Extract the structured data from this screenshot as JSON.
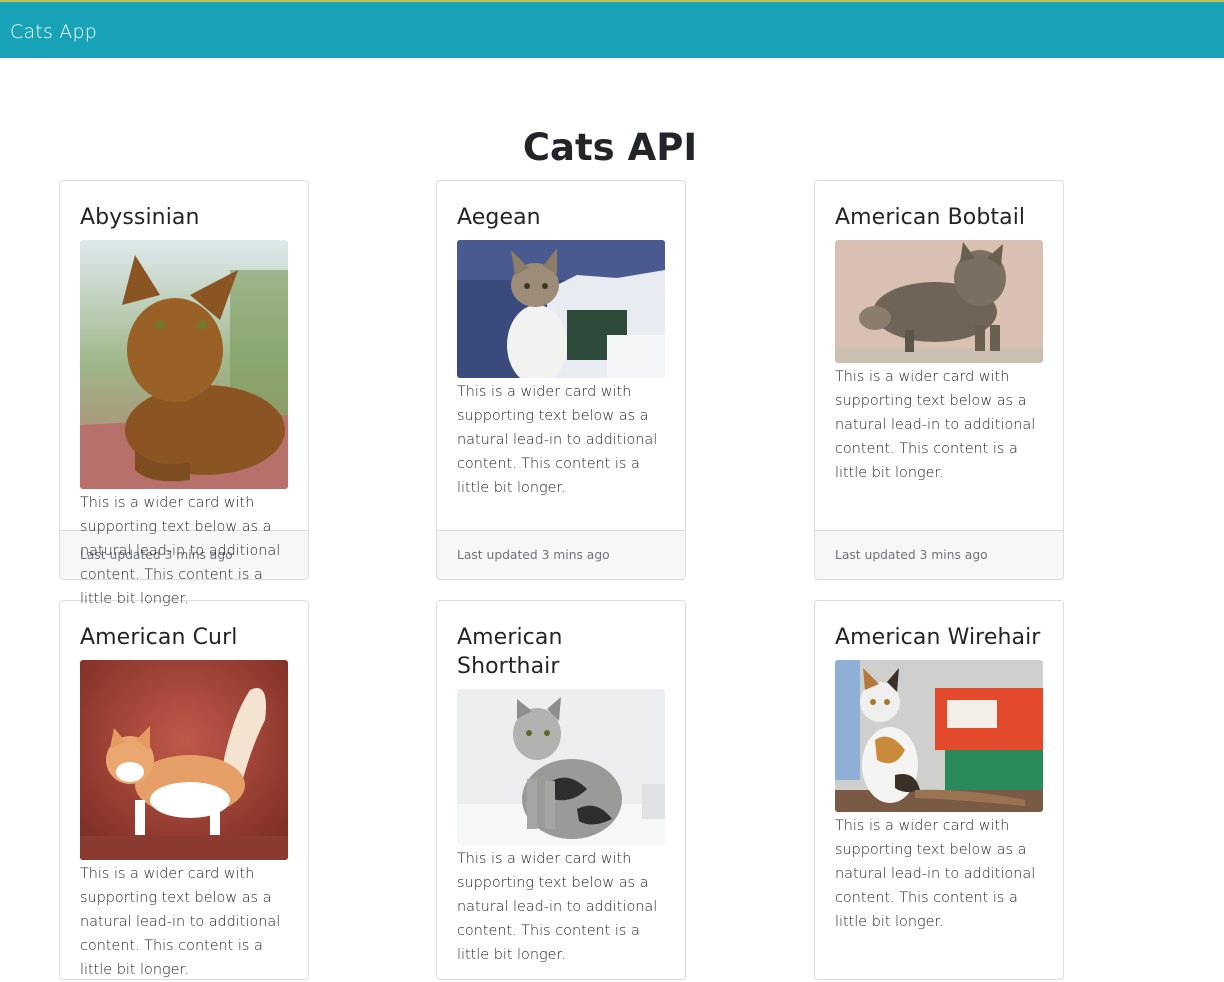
{
  "navbar": {
    "brand": "Cats App"
  },
  "page": {
    "title": "Cats API"
  },
  "cards": [
    {
      "title": "Abyssinian",
      "image": "abyssinian-cat-photo",
      "text": "This is a wider card with supporting text below as a natural lead-in to additional content. This content is a little bit longer.",
      "footer": "Last updated 3 mins ago"
    },
    {
      "title": "Aegean",
      "image": "aegean-cat-photo",
      "text": "This is a wider card with supporting text below as a natural lead-in to additional content. This content is a little bit longer.",
      "footer": "Last updated 3 mins ago"
    },
    {
      "title": "American Bobtail",
      "image": "american-bobtail-cat-photo",
      "text": "This is a wider card with supporting text below as a natural lead-in to additional content. This content is a little bit longer.",
      "footer": "Last updated 3 mins ago"
    },
    {
      "title": "American Curl",
      "image": "american-curl-cat-photo",
      "text": "This is a wider card with supporting text below as a natural lead-in to additional content. This content is a little bit longer."
    },
    {
      "title": "American Shorthair",
      "image": "american-shorthair-cat-photo",
      "text": "This is a wider card with supporting text below as a natural lead-in to additional content. This content is a little bit longer."
    },
    {
      "title": "American Wirehair",
      "image": "american-wirehair-cat-photo",
      "text": "This is a wider card with supporting text below as a natural lead-in to additional content. This content is a little bit longer."
    }
  ],
  "colors": {
    "navbar": "#17a2b8",
    "footer_bg": "#f7f7f7",
    "muted_text": "#6c757d"
  }
}
